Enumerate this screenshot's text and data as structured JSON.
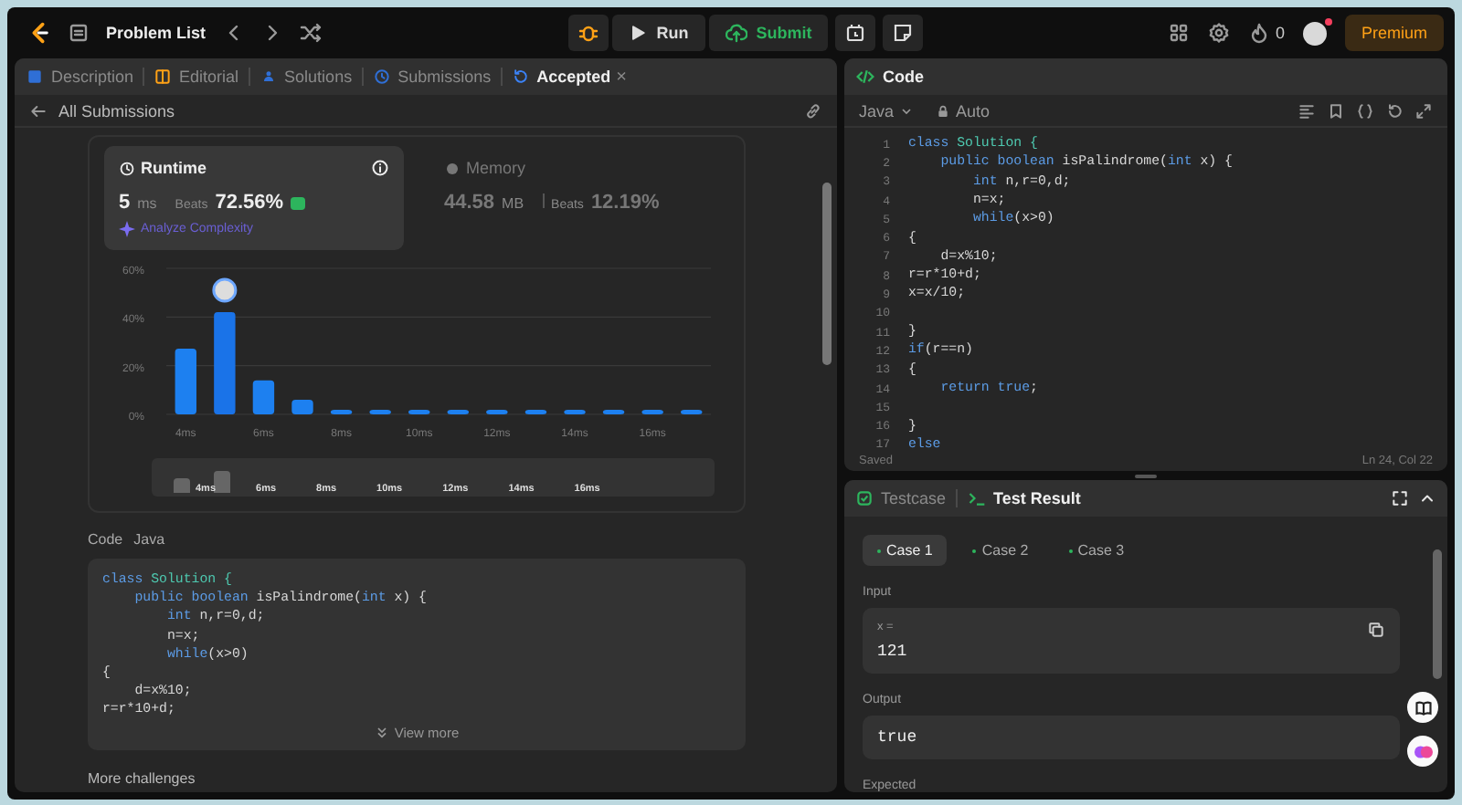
{
  "topbar": {
    "problem_list": "Problem List",
    "run": "Run",
    "submit": "Submit",
    "streak": "0",
    "premium": "Premium",
    "avatar_notification": true
  },
  "left_panel": {
    "tabs": [
      {
        "label": "Description",
        "selected": false,
        "closable": false
      },
      {
        "label": "Editorial",
        "selected": false,
        "closable": false
      },
      {
        "label": "Solutions",
        "selected": false,
        "closable": false
      },
      {
        "label": "Submissions",
        "selected": false,
        "closable": false
      },
      {
        "label": "Accepted",
        "selected": true,
        "closable": true
      }
    ],
    "close_mark": "×",
    "back_link": "All Submissions",
    "runtime": {
      "title": "Runtime",
      "value": "5",
      "unit": "ms",
      "beats_label": "Beats",
      "beats": "72.56%",
      "analyze": "Analyze Complexity",
      "selected": true
    },
    "memory": {
      "title": "Memory",
      "value": "44.58",
      "unit": "MB",
      "beats_label": "Beats",
      "beats": "12.19%",
      "selected": false
    },
    "chart_data": {
      "type": "bar",
      "x": [
        4,
        5,
        6,
        7,
        8,
        9,
        10,
        11,
        12,
        13,
        14,
        15,
        16,
        17
      ],
      "values": [
        27,
        42,
        14,
        6,
        1,
        1,
        1,
        1,
        1,
        1,
        1,
        1,
        1,
        1
      ],
      "yticks": [
        {
          "value": 0,
          "label": "0%"
        },
        {
          "value": 20,
          "label": "20%"
        },
        {
          "value": 40,
          "label": "40%"
        },
        {
          "value": 60,
          "label": "60%"
        }
      ],
      "xticks": [
        {
          "value": 4,
          "label": "4ms"
        },
        {
          "value": 6,
          "label": "6ms"
        },
        {
          "value": 8,
          "label": "8ms"
        },
        {
          "value": 10,
          "label": "10ms"
        },
        {
          "value": 12,
          "label": "12ms"
        },
        {
          "value": 14,
          "label": "14ms"
        },
        {
          "value": 16,
          "label": "16ms"
        }
      ],
      "xlim": [
        3.5,
        17.5
      ],
      "ylim": [
        0,
        60
      ]
    },
    "range_labels": [
      "4ms",
      "6ms",
      "8ms",
      "10ms",
      "12ms",
      "14ms",
      "16ms"
    ],
    "code_label": "Code",
    "code_language": "Java",
    "code": [
      [
        {
          "text": "class ",
          "kind": "kw"
        },
        {
          "text": "Solution {",
          "kind": "type"
        }
      ],
      [
        {
          "text": "    public boolean ",
          "kind": "kw"
        },
        {
          "text": "isPalindrome(",
          "kind": "plain"
        },
        {
          "text": "int",
          "kind": "kw"
        },
        {
          "text": " x) {",
          "kind": "plain"
        }
      ],
      [
        {
          "text": "        int",
          "kind": "kw"
        },
        {
          "text": " n,r=0,d;",
          "kind": "plain"
        }
      ],
      [
        {
          "text": "        n=x;",
          "kind": "plain"
        }
      ],
      [
        {
          "text": "        while",
          "kind": "kw"
        },
        {
          "text": "(x>0)",
          "kind": "plain"
        }
      ],
      [
        {
          "text": "{",
          "kind": "plain"
        }
      ],
      [
        {
          "text": "    d=x%10;",
          "kind": "plain"
        }
      ],
      [
        {
          "text": "r=r*10+d;",
          "kind": "plain"
        }
      ]
    ],
    "view_more": "View more",
    "more_challenges": "More challenges"
  },
  "editor": {
    "title": "Code",
    "language": "Java",
    "mode": "Auto",
    "lines": [
      {
        "number": "1",
        "tokens": [
          {
            "text": "class ",
            "kind": "kw"
          },
          {
            "text": "Solution {",
            "kind": "type"
          }
        ]
      },
      {
        "number": "2",
        "tokens": [
          {
            "text": "    public boolean ",
            "kind": "kw"
          },
          {
            "text": "isPalindrome(",
            "kind": "plain"
          },
          {
            "text": "int",
            "kind": "kw"
          },
          {
            "text": " x) {",
            "kind": "plain"
          }
        ]
      },
      {
        "number": "3",
        "tokens": [
          {
            "text": "        int",
            "kind": "kw"
          },
          {
            "text": " n,r=0,d;",
            "kind": "plain"
          }
        ]
      },
      {
        "number": "4",
        "tokens": [
          {
            "text": "        n=x;",
            "kind": "plain"
          }
        ]
      },
      {
        "number": "5",
        "tokens": [
          {
            "text": "        while",
            "kind": "kw"
          },
          {
            "text": "(x>0)",
            "kind": "plain"
          }
        ]
      },
      {
        "number": "6",
        "tokens": [
          {
            "text": "{",
            "kind": "plain"
          }
        ]
      },
      {
        "number": "7",
        "tokens": [
          {
            "text": "    d=x%10;",
            "kind": "plain"
          }
        ]
      },
      {
        "number": "8",
        "tokens": [
          {
            "text": "r=r*10+d;",
            "kind": "plain"
          }
        ]
      },
      {
        "number": "9",
        "tokens": [
          {
            "text": "x=x/10;",
            "kind": "plain"
          }
        ]
      },
      {
        "number": "10"
      },
      {
        "number": "11",
        "tokens": [
          {
            "text": "}",
            "kind": "plain"
          }
        ]
      },
      {
        "number": "12",
        "tokens": [
          {
            "text": "if",
            "kind": "kw"
          },
          {
            "text": "(r==n)",
            "kind": "plain"
          }
        ]
      },
      {
        "number": "13",
        "tokens": [
          {
            "text": "{",
            "kind": "plain"
          }
        ]
      },
      {
        "number": "14",
        "tokens": [
          {
            "text": "    return ",
            "kind": "kw"
          },
          {
            "text": "true",
            "kind": "kw"
          },
          {
            "text": ";",
            "kind": "plain"
          }
        ]
      },
      {
        "number": "15"
      },
      {
        "number": "16",
        "tokens": [
          {
            "text": "}",
            "kind": "plain"
          }
        ]
      },
      {
        "number": "17",
        "tokens": [
          {
            "text": "else",
            "kind": "kw"
          }
        ]
      }
    ],
    "status": "Saved",
    "cursor": "Ln 24, Col 22"
  },
  "results": {
    "tabs": [
      {
        "label": "Testcase",
        "selected": false
      },
      {
        "label": "Test Result",
        "selected": true
      }
    ],
    "cases": [
      {
        "label": "Case 1",
        "selected": true
      },
      {
        "label": "Case 2",
        "selected": false
      },
      {
        "label": "Case 3",
        "selected": false
      }
    ],
    "input_label": "Input",
    "variable": "x =",
    "input_value": "121",
    "output_label": "Output",
    "output_value": "true",
    "expected_label": "Expected"
  }
}
